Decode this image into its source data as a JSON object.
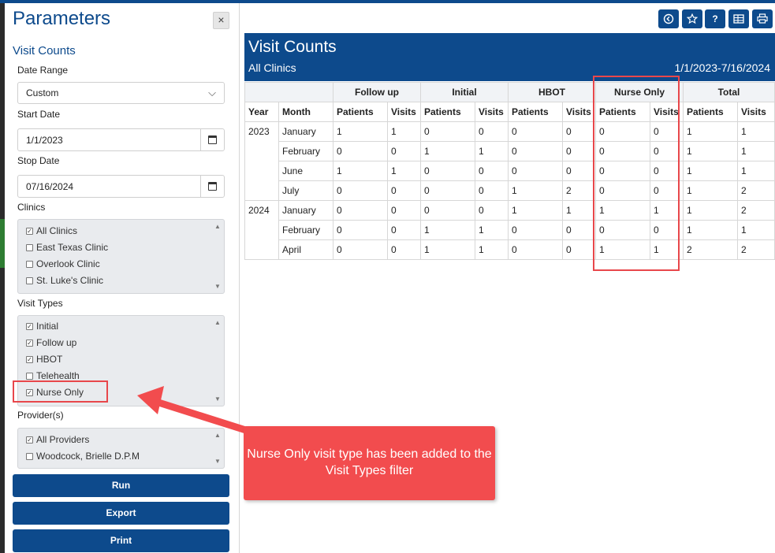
{
  "params": {
    "title": "Parameters",
    "close_glyph": "×",
    "subtitle": "Visit Counts",
    "date_range": {
      "label": "Date Range",
      "value": "Custom"
    },
    "start_date": {
      "label": "Start Date",
      "value": "1/1/2023"
    },
    "stop_date": {
      "label": "Stop Date",
      "value": "07/16/2024"
    },
    "clinics": {
      "label": "Clinics",
      "items": [
        {
          "label": "All Clinics",
          "checked": true
        },
        {
          "label": "East Texas Clinic",
          "checked": false
        },
        {
          "label": "Overlook Clinic",
          "checked": false
        },
        {
          "label": "St. Luke's Clinic",
          "checked": false
        }
      ]
    },
    "visit_types": {
      "label": "Visit Types",
      "items": [
        {
          "label": "Initial",
          "checked": true
        },
        {
          "label": "Follow up",
          "checked": true
        },
        {
          "label": "HBOT",
          "checked": true
        },
        {
          "label": "Telehealth",
          "checked": false
        },
        {
          "label": "Nurse Only",
          "checked": true
        }
      ]
    },
    "providers": {
      "label": "Provider(s)",
      "items": [
        {
          "label": "All Providers",
          "checked": true
        },
        {
          "label": "Woodcock, Brielle D.P.M",
          "checked": false
        }
      ]
    },
    "buttons": {
      "run": "Run",
      "export": "Export",
      "print": "Print"
    }
  },
  "toolbar": {
    "icons": [
      "back-circle-icon",
      "star-icon",
      "help-icon",
      "table-icon",
      "print-icon"
    ],
    "help_glyph": "?"
  },
  "report": {
    "title": "Visit Counts",
    "subtitle": "All Clinics",
    "date_range": "1/1/2023-7/16/2024",
    "group_headers": [
      "Follow up",
      "Initial",
      "HBOT",
      "Nurse Only",
      "Total"
    ],
    "sub_headers": [
      "Year",
      "Month",
      "Patients",
      "Visits",
      "Patients",
      "Visits",
      "Patients",
      "Visits",
      "Patients",
      "Visits",
      "Patients",
      "Visits"
    ],
    "years": [
      {
        "year": "2023",
        "rows": [
          {
            "month": "January",
            "values": [
              "1",
              "1",
              "0",
              "0",
              "0",
              "0",
              "0",
              "0",
              "1",
              "1"
            ]
          },
          {
            "month": "February",
            "values": [
              "0",
              "0",
              "1",
              "1",
              "0",
              "0",
              "0",
              "0",
              "1",
              "1"
            ]
          },
          {
            "month": "June",
            "values": [
              "1",
              "1",
              "0",
              "0",
              "0",
              "0",
              "0",
              "0",
              "1",
              "1"
            ]
          },
          {
            "month": "July",
            "values": [
              "0",
              "0",
              "0",
              "0",
              "1",
              "2",
              "0",
              "0",
              "1",
              "2"
            ]
          }
        ]
      },
      {
        "year": "2024",
        "rows": [
          {
            "month": "January",
            "values": [
              "0",
              "0",
              "0",
              "0",
              "1",
              "1",
              "1",
              "1",
              "1",
              "2"
            ]
          },
          {
            "month": "February",
            "values": [
              "0",
              "0",
              "1",
              "1",
              "0",
              "0",
              "0",
              "0",
              "1",
              "1"
            ]
          },
          {
            "month": "April",
            "values": [
              "0",
              "0",
              "1",
              "1",
              "0",
              "0",
              "1",
              "1",
              "2",
              "2"
            ]
          }
        ]
      }
    ]
  },
  "callout": {
    "text": "Nurse Only visit type has been added to the Visit Types filter"
  },
  "colors": {
    "brand": "#0d4a8c",
    "callout": "#f24c4e",
    "highlight": "#e8474b"
  }
}
